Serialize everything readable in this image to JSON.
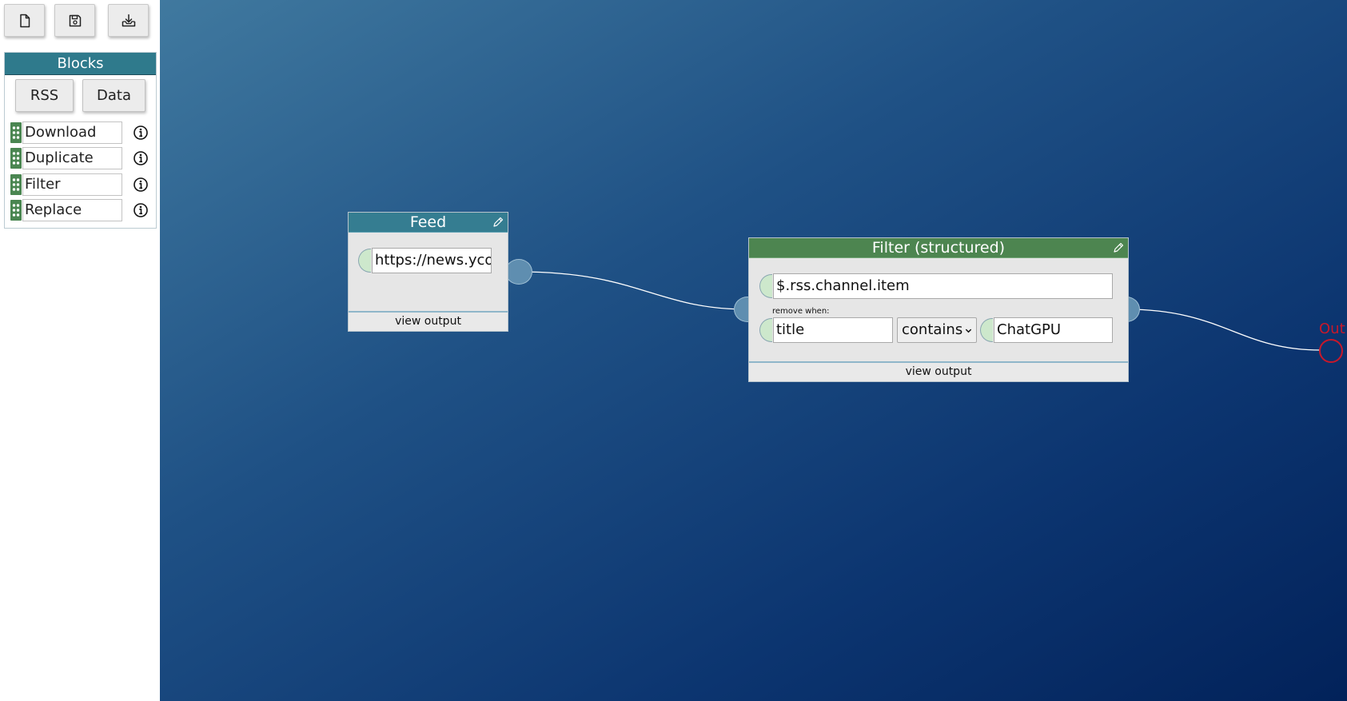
{
  "toolbar": {
    "new_icon": "file-icon",
    "save_icon": "floppy-disk-icon",
    "download_icon": "download-tray-icon"
  },
  "blocks_panel": {
    "title": "Blocks",
    "tabs": [
      {
        "label": "RSS"
      },
      {
        "label": "Data"
      }
    ],
    "items": [
      {
        "label": "Download"
      },
      {
        "label": "Duplicate"
      },
      {
        "label": "Filter"
      },
      {
        "label": "Replace"
      }
    ]
  },
  "canvas": {
    "feed_node": {
      "title": "Feed",
      "url_value": "https://news.ycombinator.com/rss",
      "footer": "view output"
    },
    "filter_node": {
      "title": "Filter (structured)",
      "path_value": "$.rss.channel.item",
      "remove_when_label": "remove when:",
      "field_value": "title",
      "operator_value": "contains",
      "match_value": "ChatGPU",
      "footer": "view output"
    },
    "output": {
      "label": "Out"
    }
  },
  "colors": {
    "feed_header": "#357d91",
    "filter_header": "#4d8550",
    "output": "#c8182a",
    "canvas_start": "#40799f",
    "canvas_end": "#02225a"
  }
}
